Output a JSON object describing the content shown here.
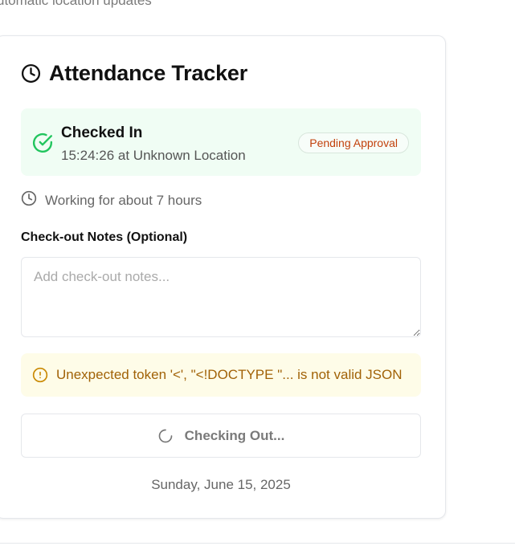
{
  "top_hint": "utomatic location updates",
  "card": {
    "title": "Attendance Tracker",
    "title_icon": "clock-icon"
  },
  "status": {
    "title": "Checked In",
    "detail": "15:24:26 at Unknown Location",
    "badge": "Pending Approval",
    "icon": "check-circle-icon",
    "colors": {
      "background": "#f0fdf4",
      "icon": "#22c55e",
      "badge_text": "#c2410c"
    }
  },
  "working": {
    "text": "Working for about 7 hours",
    "icon": "clock-icon"
  },
  "notes": {
    "label": "Check-out Notes (Optional)",
    "placeholder": "Add check-out notes...",
    "value": ""
  },
  "error": {
    "message": "Unexpected token '<', \"<!DOCTYPE \"... is not valid JSON",
    "icon": "alert-circle-icon",
    "colors": {
      "background": "#fefce8",
      "text": "#a16207"
    }
  },
  "checkout_button": {
    "label": "Checking Out...",
    "icon": "spinner-icon"
  },
  "date": "Sunday, June 15, 2025"
}
